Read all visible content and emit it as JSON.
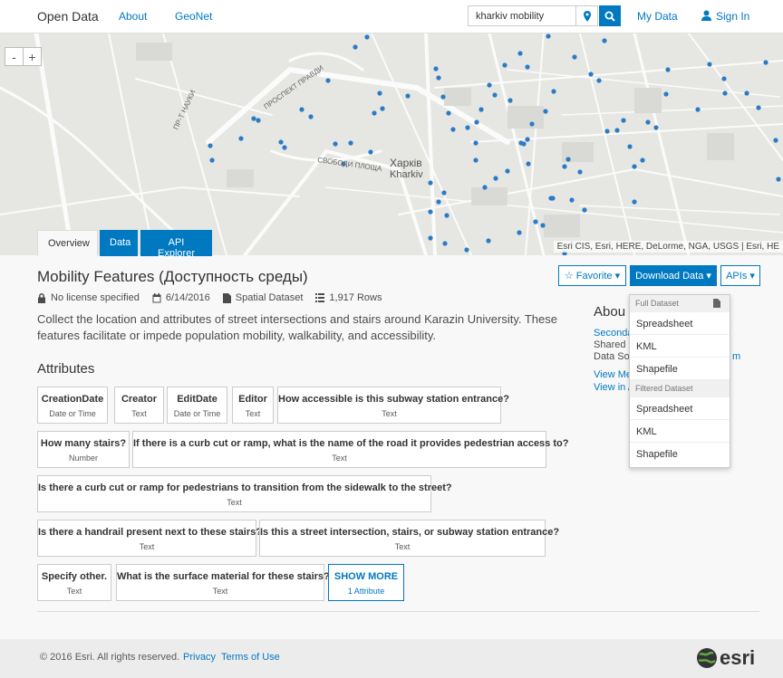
{
  "header": {
    "brand": "Open Data",
    "nav": [
      "About",
      "GeoNet"
    ],
    "search_value": "kharkiv mobility",
    "my_data": "My Data",
    "sign_in": "Sign In"
  },
  "map": {
    "zoom_out": "-",
    "zoom_in": "+",
    "city_label_1": "Харків",
    "city_label_2": "Kharkiv",
    "attribution": "Esri CIS, Esri, HERE, DeLorme, NGA, USGS | Esri, HE",
    "street_labels": [
      "ПР-Т НАУКИ",
      "ПРОСПЕКТ ПРАВДИ",
      "СВОБОДИ ПЛОЩА"
    ]
  },
  "tabs": [
    "Overview",
    "Data",
    "API Explorer"
  ],
  "dataset": {
    "title": "Mobility Features (Доступность среды)",
    "license": "No license specified",
    "date": "6/14/2016",
    "type": "Spatial Dataset",
    "rows": "1,917 Rows",
    "description": "Collect the location and attributes of street intersections and stairs around Karazin University. These features facilitate or impede population mobility, walkability, and accessibility."
  },
  "actions": {
    "favorite": "☆ Favorite ▾",
    "download": "Download Data ▾",
    "apis": "APIs ▾"
  },
  "download_menu": {
    "full_header": "Full Dataset",
    "full_items": [
      "Spreadsheet",
      "KML",
      "Shapefile"
    ],
    "filtered_header": "Filtered Dataset",
    "filtered_items": [
      "Spreadsheet",
      "KML",
      "Shapefile"
    ]
  },
  "about": {
    "heading": "Abou",
    "lines": [
      "Seconda",
      "Shared E",
      "Data Sou",
      "View Me",
      "View in A"
    ],
    "tail_m": "m"
  },
  "attributes": {
    "heading": "Attributes",
    "items": [
      {
        "name": "CreationDate",
        "type": "Date or Time"
      },
      {
        "name": "Creator",
        "type": "Text"
      },
      {
        "name": "EditDate",
        "type": "Date or Time"
      },
      {
        "name": "Editor",
        "type": "Text"
      },
      {
        "name": "How accessible is this subway station entrance?",
        "type": "Text"
      },
      {
        "name": "How many stairs?",
        "type": "Number"
      },
      {
        "name": "If there is a curb cut or ramp, what is the name of the road it provides pedestrian access to?",
        "type": "Text"
      },
      {
        "name": "Is there a curb cut or ramp for pedestrians to transition from the sidewalk to the street?",
        "type": "Text"
      },
      {
        "name": "Is there a handrail present next to these stairs?",
        "type": "Text"
      },
      {
        "name": "Is this a street intersection, stairs, or subway station entrance?",
        "type": "Text"
      },
      {
        "name": "Specify other.",
        "type": "Text"
      },
      {
        "name": "What is the surface material for these stairs?",
        "type": "Text"
      }
    ],
    "show_more": "SHOW MORE",
    "show_more_sub": "1 Attribute"
  },
  "footer": {
    "copyright": "© 2016 Esri. All rights reserved.",
    "privacy": "Privacy",
    "terms": "Terms of Use",
    "logo": "esri"
  },
  "colors": {
    "accent": "#0079c1",
    "point": "#2b7bc4",
    "map_bg": "#e6e6e3"
  }
}
